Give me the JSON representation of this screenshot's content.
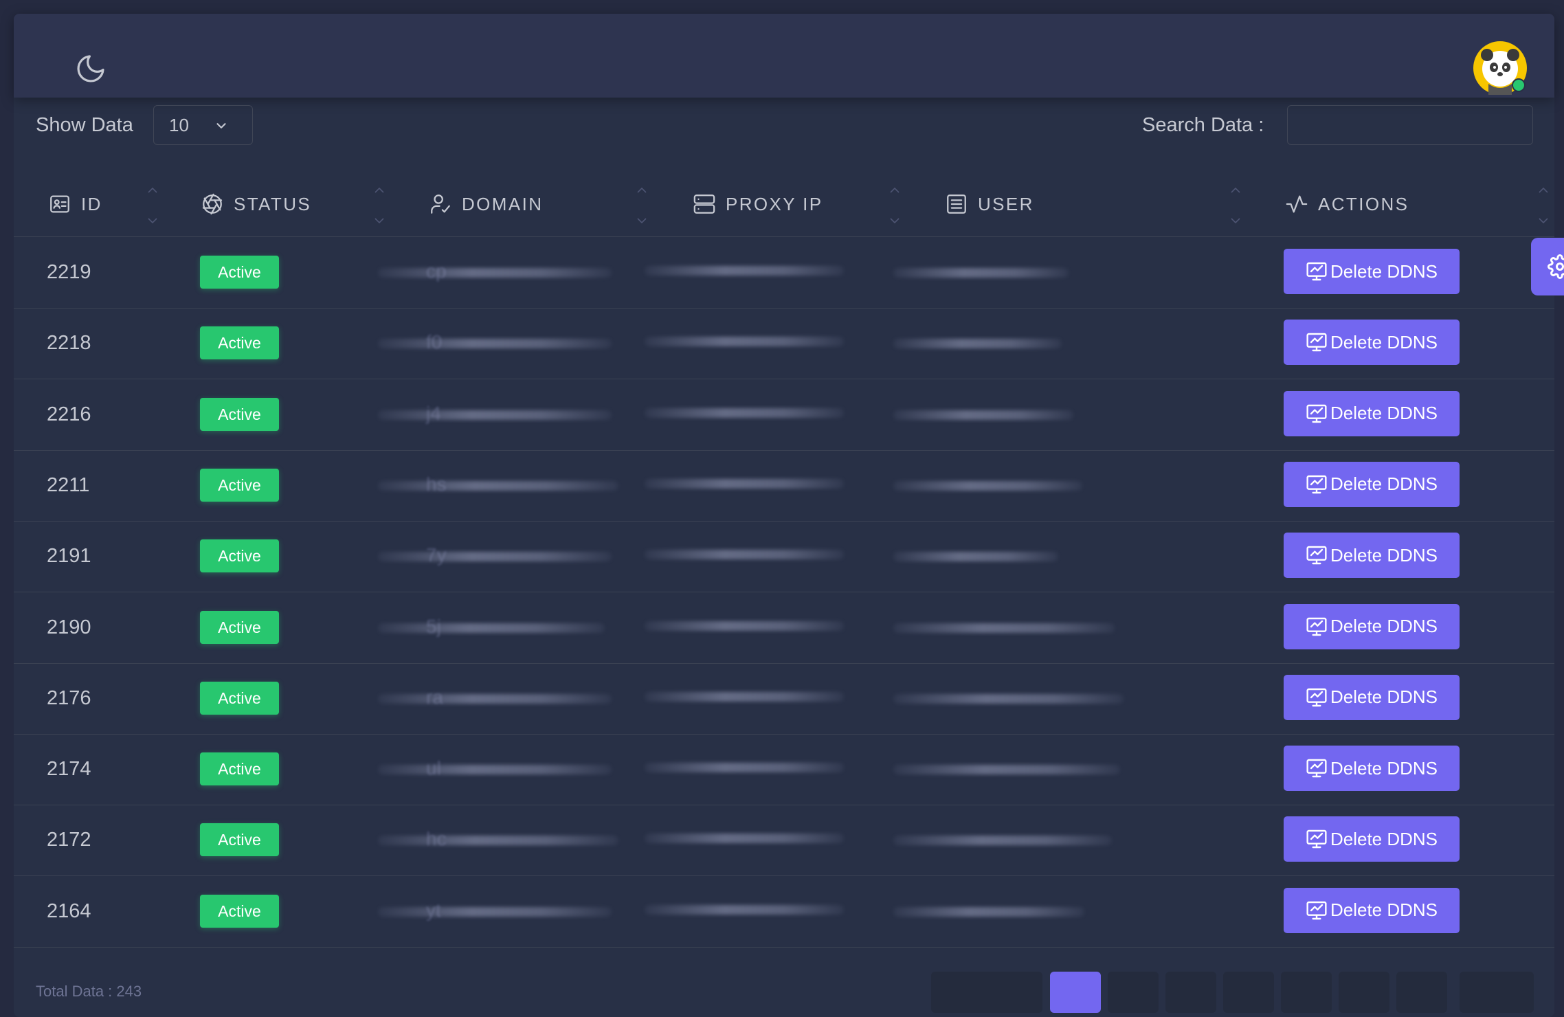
{
  "header": {
    "theme_toggle_icon": "moon-icon",
    "avatar_icon": "panda-avatar-icon",
    "online_color": "#28c76f"
  },
  "toolbar": {
    "show_label": "Show Data",
    "page_size": "10",
    "search_label": "Search Data :",
    "search_value": ""
  },
  "table": {
    "columns": [
      {
        "label": "ID",
        "icon": "id-card-icon"
      },
      {
        "label": "STATUS",
        "icon": "aperture-icon"
      },
      {
        "label": "DOMAIN",
        "icon": "user-check-icon"
      },
      {
        "label": "PROXY IP",
        "icon": "server-icon"
      },
      {
        "label": "USER",
        "icon": "list-icon"
      },
      {
        "label": "ACTIONS",
        "icon": "activity-icon"
      }
    ],
    "rows": [
      {
        "id": "2219",
        "status": "Active",
        "domain_hint": "cp",
        "action": "Delete DDNS"
      },
      {
        "id": "2218",
        "status": "Active",
        "domain_hint": "f0",
        "action": "Delete DDNS"
      },
      {
        "id": "2216",
        "status": "Active",
        "domain_hint": "j4",
        "action": "Delete DDNS"
      },
      {
        "id": "2211",
        "status": "Active",
        "domain_hint": "hs",
        "action": "Delete DDNS"
      },
      {
        "id": "2191",
        "status": "Active",
        "domain_hint": "7y",
        "action": "Delete DDNS"
      },
      {
        "id": "2190",
        "status": "Active",
        "domain_hint": "5j",
        "action": "Delete DDNS"
      },
      {
        "id": "2176",
        "status": "Active",
        "domain_hint": "ra",
        "action": "Delete DDNS"
      },
      {
        "id": "2174",
        "status": "Active",
        "domain_hint": "ul",
        "action": "Delete DDNS"
      },
      {
        "id": "2172",
        "status": "Active",
        "domain_hint": "hc",
        "action": "Delete DDNS"
      },
      {
        "id": "2164",
        "status": "Active",
        "domain_hint": "yt",
        "action": "Delete DDNS"
      }
    ]
  },
  "footer": {
    "total_text": "Total Data : 243"
  },
  "colors": {
    "accent": "#7367f0",
    "success": "#28c76f",
    "background": "#252a40",
    "card": "#283046"
  }
}
